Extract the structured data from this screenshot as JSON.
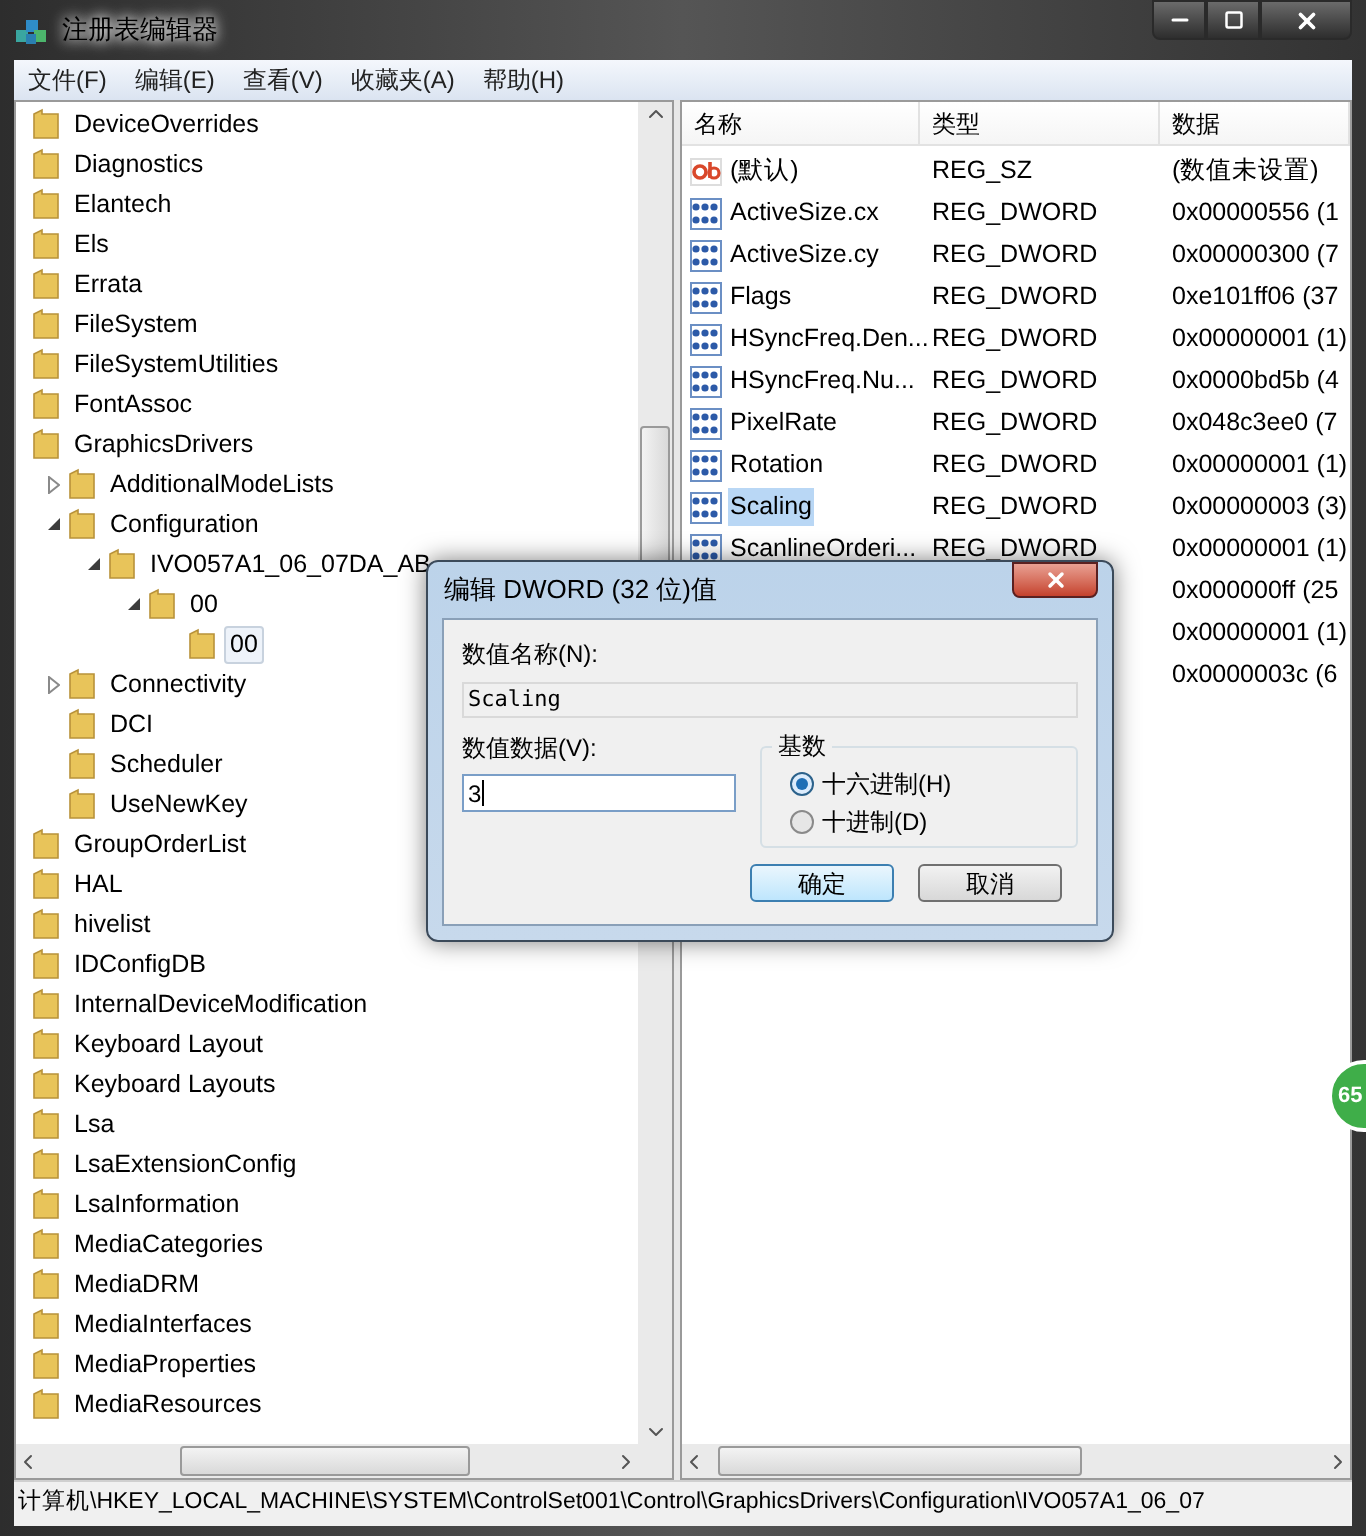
{
  "window": {
    "title": "注册表编辑器"
  },
  "menu": [
    "文件(F)",
    "编辑(E)",
    "查看(V)",
    "收藏夹(A)",
    "帮助(H)"
  ],
  "tree": [
    {
      "label": "DeviceOverrides",
      "selected": false
    },
    {
      "label": "Diagnostics",
      "selected": false
    },
    {
      "label": "Elantech",
      "selected": false
    },
    {
      "label": "Els",
      "selected": false
    },
    {
      "label": "Errata",
      "selected": false
    },
    {
      "label": "FileSystem",
      "selected": false
    },
    {
      "label": "FileSystemUtilities",
      "selected": false
    },
    {
      "label": "FontAssoc",
      "selected": false
    },
    {
      "label": "GraphicsDrivers",
      "selected": false,
      "children": [
        {
          "label": "AdditionalModeLists",
          "selected": false,
          "expanded": false
        },
        {
          "label": "Configuration",
          "selected": false,
          "expanded": true,
          "children": [
            {
              "label": "IVO057A1_06_07DA_AB",
              "selected": false,
              "expanded": true,
              "children": [
                {
                  "label": "00",
                  "selected": false,
                  "expanded": true,
                  "children": [
                    {
                      "label": "00",
                      "selected": true
                    }
                  ]
                }
              ]
            }
          ]
        },
        {
          "label": "Connectivity",
          "selected": false,
          "expanded": false
        },
        {
          "label": "DCI",
          "selected": false
        },
        {
          "label": "Scheduler",
          "selected": false
        },
        {
          "label": "UseNewKey",
          "selected": false
        }
      ]
    },
    {
      "label": "GroupOrderList",
      "selected": false
    },
    {
      "label": "HAL",
      "selected": false
    },
    {
      "label": "hivelist",
      "selected": false
    },
    {
      "label": "IDConfigDB",
      "selected": false
    },
    {
      "label": "InternalDeviceModification",
      "selected": false
    },
    {
      "label": "Keyboard Layout",
      "selected": false
    },
    {
      "label": "Keyboard Layouts",
      "selected": false
    },
    {
      "label": "Lsa",
      "selected": false
    },
    {
      "label": "LsaExtensionConfig",
      "selected": false
    },
    {
      "label": "LsaInformation",
      "selected": false
    },
    {
      "label": "MediaCategories",
      "selected": false
    },
    {
      "label": "MediaDRM",
      "selected": false
    },
    {
      "label": "MediaInterfaces",
      "selected": false
    },
    {
      "label": "MediaProperties",
      "selected": false
    },
    {
      "label": "MediaResources",
      "selected": false
    }
  ],
  "values": {
    "columns": [
      "名称",
      "类型",
      "数据"
    ],
    "rows": [
      {
        "kind": "string",
        "name": "(默认)",
        "type": "REG_SZ",
        "data": "(数值未设置)",
        "selected": false
      },
      {
        "kind": "binary",
        "name": "ActiveSize.cx",
        "type": "REG_DWORD",
        "data": "0x00000556 (1",
        "selected": false
      },
      {
        "kind": "binary",
        "name": "ActiveSize.cy",
        "type": "REG_DWORD",
        "data": "0x00000300 (7",
        "selected": false
      },
      {
        "kind": "binary",
        "name": "Flags",
        "type": "REG_DWORD",
        "data": "0xe101ff06 (37",
        "selected": false
      },
      {
        "kind": "binary",
        "name": "HSyncFreq.Den...",
        "type": "REG_DWORD",
        "data": "0x00000001 (1)",
        "selected": false
      },
      {
        "kind": "binary",
        "name": "HSyncFreq.Nu...",
        "type": "REG_DWORD",
        "data": "0x0000bd5b (4",
        "selected": false
      },
      {
        "kind": "binary",
        "name": "PixelRate",
        "type": "REG_DWORD",
        "data": "0x048c3ee0 (7",
        "selected": false
      },
      {
        "kind": "binary",
        "name": "Rotation",
        "type": "REG_DWORD",
        "data": "0x00000001 (1)",
        "selected": false
      },
      {
        "kind": "binary",
        "name": "Scaling",
        "type": "REG_DWORD",
        "data": "0x00000003 (3)",
        "selected": true
      },
      {
        "kind": "binary",
        "name": "ScanlineOrderi...",
        "type": "REG_DWORD",
        "data": "0x00000001 (1)",
        "selected": false
      },
      {
        "kind": "hidden",
        "data": "0x000000ff (25"
      },
      {
        "kind": "hidden",
        "data": "0x00000001 (1)"
      },
      {
        "kind": "hidden",
        "data": "0x0000003c (6"
      }
    ]
  },
  "status_bar": "计算机\\HKEY_LOCAL_MACHINE\\SYSTEM\\ControlSet001\\Control\\GraphicsDrivers\\Configuration\\IVO057A1_06_07",
  "dialog": {
    "title": "编辑 DWORD (32 位)值",
    "name_label": "数值名称(N):",
    "name_value": "Scaling",
    "data_label": "数值数据(V):",
    "data_value": "3",
    "base_label": "基数",
    "bases": [
      {
        "label": "十六进制(H)",
        "selected": true
      },
      {
        "label": "十进制(D)",
        "selected": false
      }
    ],
    "buttons": [
      {
        "label": "确定",
        "default": true
      },
      {
        "label": "取消",
        "default": false
      }
    ]
  },
  "floating_badge": "65"
}
